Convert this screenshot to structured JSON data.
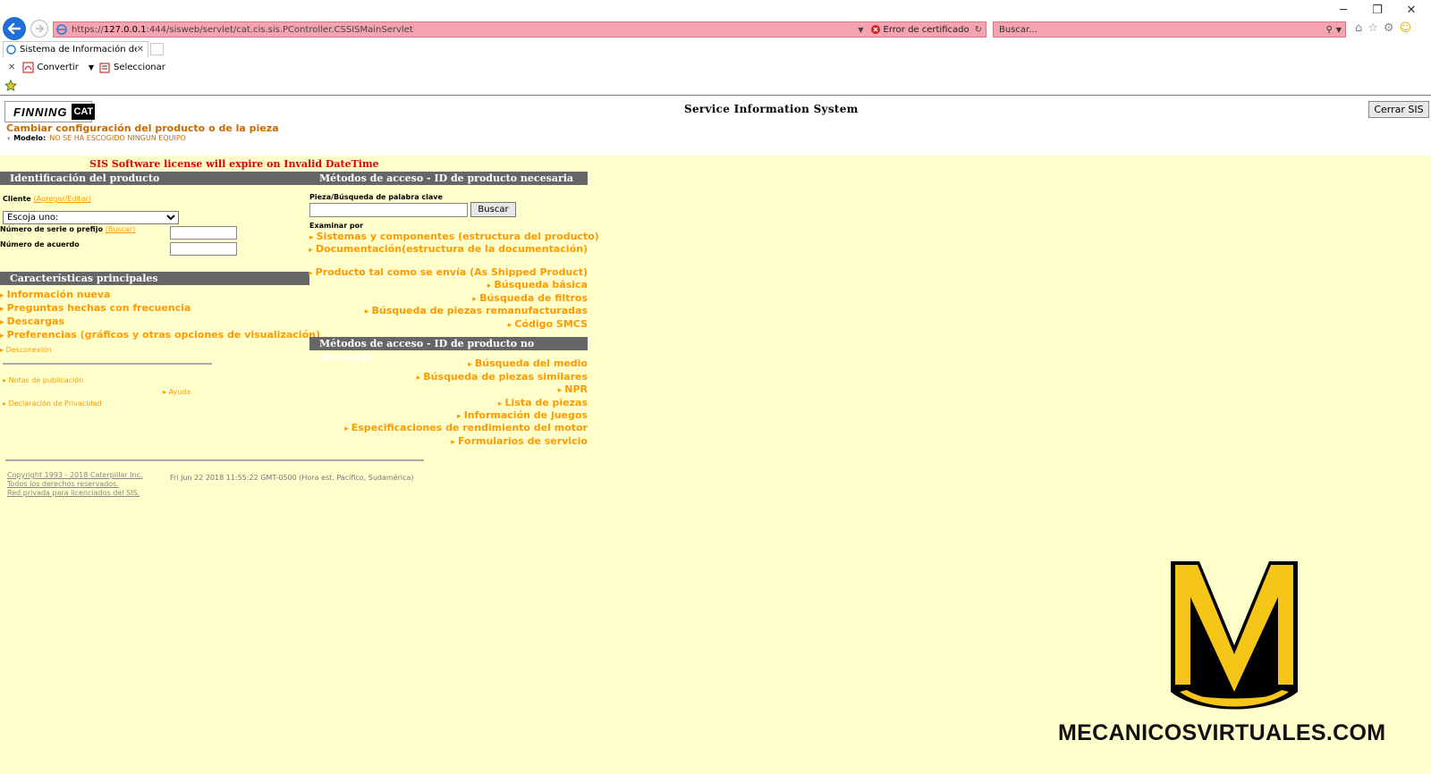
{
  "browser": {
    "url_prefix": "https://",
    "url_host": "127.0.0.1",
    "url_rest": ":444/sisweb/servlet/cat.cis.sis.PController.CSSISMainServlet",
    "cert_error": "Error de certificado",
    "search_placeholder": "Buscar...",
    "tab_label": "Sistema de Información de ...",
    "cmd_convert": "Convertir",
    "cmd_select": "Seleccionar"
  },
  "header": {
    "logo_finning": "FINNING",
    "logo_cat": "CAT",
    "title": "Service Information System",
    "close_button": "Cerrar SIS",
    "change_config": "Cambiar configuración del producto o de la pieza",
    "model_label": "Modelo:",
    "model_value": "NO SE HA ESCOGIDO NINGUN EQUIPO"
  },
  "license_warning": "SIS Software license will expire on Invalid DateTime",
  "product_id": {
    "title": "Identificación del producto",
    "customer_label": "Cliente",
    "customer_link": "(Agregar/Editar)",
    "customer_selected": "Escoja uno:",
    "serial_label": "Número de serie o prefijo",
    "serial_link": "(Buscar)",
    "agreement_label": "Número de acuerdo"
  },
  "main_features": {
    "title": "Características principales",
    "items": [
      "Información nueva",
      "Preguntas hechas con frecuencia",
      "Descargas",
      "Preferencias (gráficos y otras opciones de visualización)"
    ],
    "logout": "Desconexión",
    "release_notes": "Notas de publicación",
    "help": "Ayuda",
    "privacy": "Declaración de Privacidad"
  },
  "access_required": {
    "title": "Métodos de acceso - ID de producto necesaria",
    "keyword_label": "Pieza/Búsqueda de palabra clave",
    "search_button": "Buscar",
    "browse_label": "Examinar por",
    "items": [
      "Sistemas y componentes (estructura del producto)",
      "Documentación(estructura de la documentación)",
      "Producto tal como se envía (As Shipped Product)",
      "Búsqueda básica",
      "Búsqueda de filtros",
      "Búsqueda de piezas remanufacturadas",
      "Código SMCS"
    ]
  },
  "access_not_required": {
    "title": "Métodos de acceso - ID de producto no necesaria",
    "items": [
      "Búsqueda del medio",
      "Búsqueda de piezas similares",
      "NPR",
      "Lista de piezas",
      "Información de juegos",
      "Especificaciones de rendimiento del motor",
      "Formularios de servicio"
    ]
  },
  "footer": {
    "copyright_1": "Copyright 1993 - 2018 Caterpillar Inc.",
    "copyright_2": "Todos los derechos reservados.",
    "copyright_3": "Red privada para licenciados del SIS.",
    "timestamp": "Fri Jun 22 2018 11:55:22 GMT-0500 (Hora est. Pacífico, Sudamérica)"
  },
  "watermark": {
    "text": "MECANICOSVIRTUALES.COM",
    "colors": {
      "yellow": "#f5c518",
      "black": "#000000"
    }
  },
  "colors": {
    "accent_orange": "#ff9900",
    "page_bg": "#ffffcc",
    "bar_gray": "#666666",
    "license_red": "#e00000"
  }
}
